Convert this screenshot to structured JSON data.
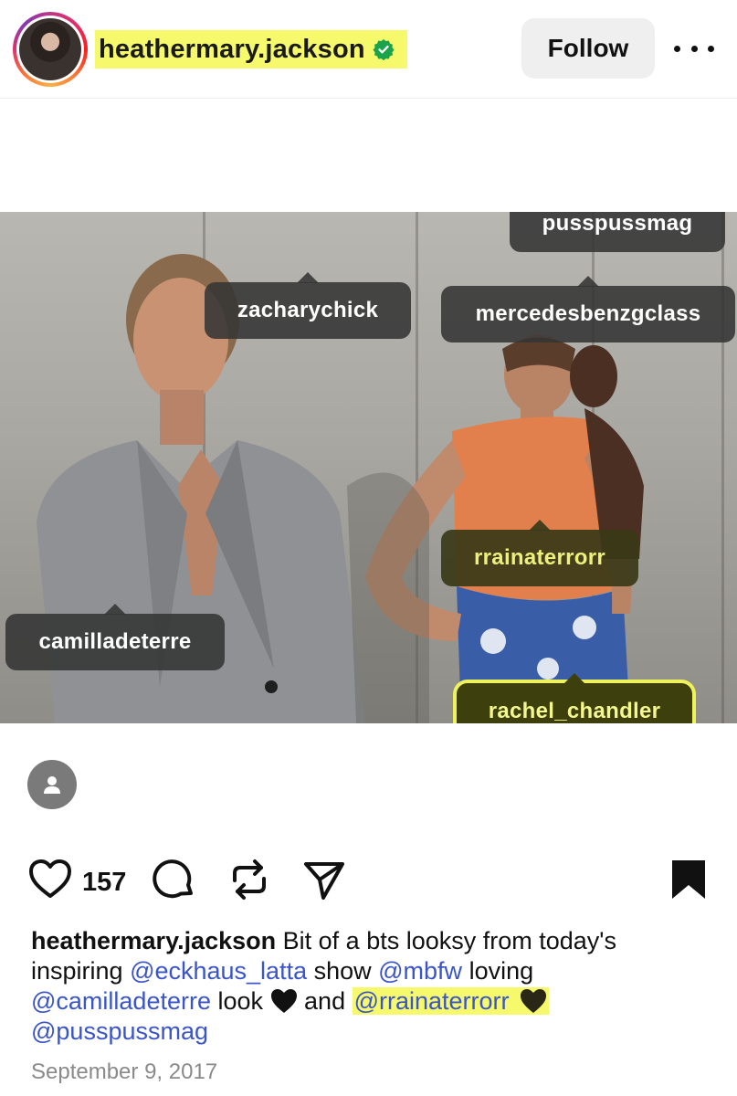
{
  "header": {
    "username": "heathermary.jackson",
    "follow_label": "Follow"
  },
  "tags": [
    {
      "label": "pusspussmag"
    },
    {
      "label": "zacharychick"
    },
    {
      "label": "mercedesbenzgclass"
    },
    {
      "label": "rrainaterrorr"
    },
    {
      "label": "camilladeterre"
    },
    {
      "label": "rachel_chandler"
    }
  ],
  "actions": {
    "like_count": "157"
  },
  "caption": {
    "author": "heathermary.jackson",
    "text_1": " Bit of a bts looksy from today's inspiring ",
    "mention_1": "@eckhaus_latta",
    "text_2": " show ",
    "mention_2": "@mbfw",
    "text_3": " loving ",
    "mention_3": "@camilladeterre",
    "text_4": " look ",
    "text_5": " and ",
    "mention_4": "@rrainaterrorr",
    "mention_5": "@pusspussmag"
  },
  "date": "September 9, 2017",
  "colors": {
    "highlight": "#f5f96b",
    "mention": "#3a54c9",
    "verified": "#1aa34a"
  }
}
